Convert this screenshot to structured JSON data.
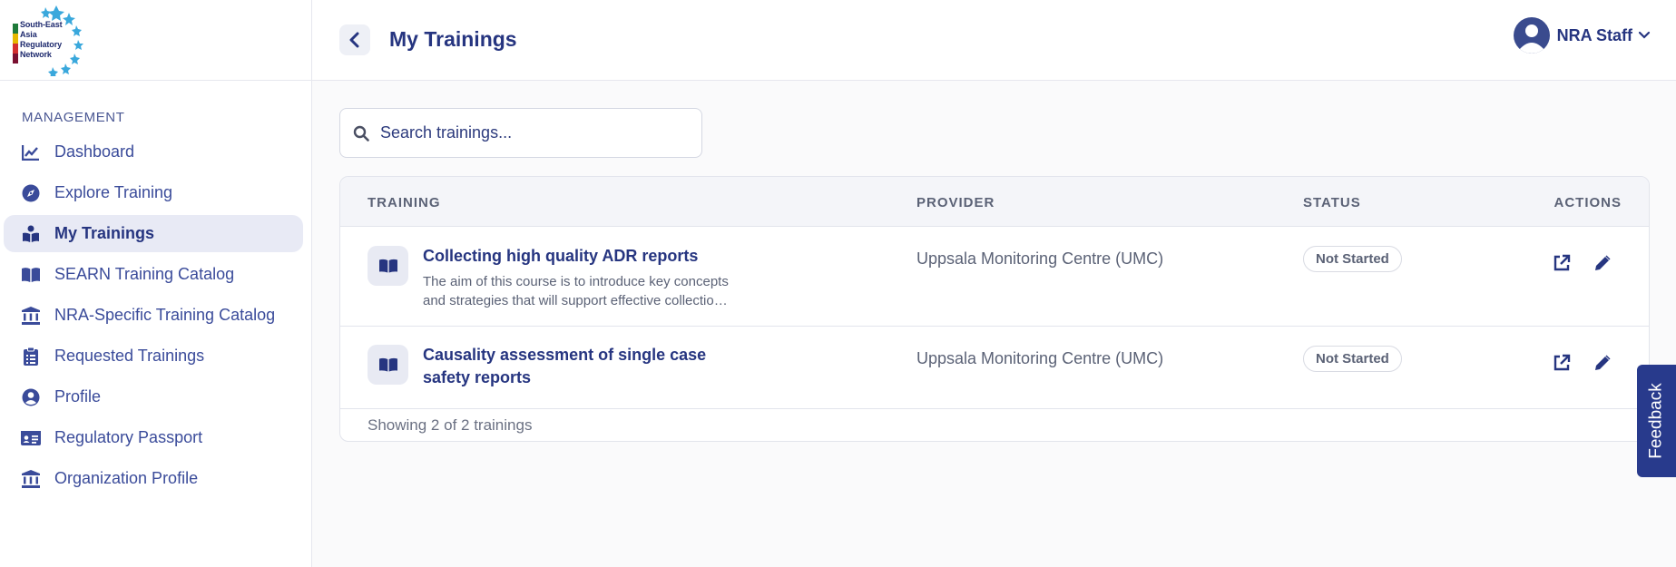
{
  "logo": {
    "lines": [
      "South-East",
      "Asia",
      "Regulatory",
      "Network"
    ],
    "bar_colors": [
      "#1e7a3a",
      "#e6b800",
      "#d32f2f",
      "#7a1030"
    ]
  },
  "sidebar": {
    "section_label": "MANAGEMENT",
    "items": [
      {
        "label": "Dashboard",
        "icon": "chart-line-icon"
      },
      {
        "label": "Explore Training",
        "icon": "compass-icon"
      },
      {
        "label": "My Trainings",
        "icon": "book-reader-icon",
        "active": true
      },
      {
        "label": "SEARN Training Catalog",
        "icon": "book-open-icon"
      },
      {
        "label": "NRA-Specific Training Catalog",
        "icon": "institution-icon"
      },
      {
        "label": "Requested Trainings",
        "icon": "clipboard-icon"
      },
      {
        "label": "Profile",
        "icon": "user-circle-icon"
      },
      {
        "label": "Regulatory Passport",
        "icon": "id-card-icon"
      },
      {
        "label": "Organization Profile",
        "icon": "institution-icon"
      }
    ]
  },
  "header": {
    "title": "My Trainings",
    "user_name": "NRA Staff"
  },
  "search": {
    "placeholder": "Search trainings..."
  },
  "table": {
    "columns": [
      "TRAINING",
      "PROVIDER",
      "STATUS",
      "ACTIONS"
    ],
    "rows": [
      {
        "title": "Collecting high quality ADR reports",
        "description": "The aim of this course is to introduce key concepts and strategies that will support effective collectio…",
        "provider": "Uppsala Monitoring Centre (UMC)",
        "status": "Not Started"
      },
      {
        "title": "Causality assessment of single case safety reports",
        "description": "",
        "provider": "Uppsala Monitoring Centre (UMC)",
        "status": "Not Started"
      }
    ],
    "footer": "Showing 2 of 2 trainings"
  },
  "feedback": {
    "label": "Feedback"
  },
  "colors": {
    "primary": "#263580",
    "active_bg": "#e8eaf5",
    "feedback_bg": "#283a8c"
  }
}
